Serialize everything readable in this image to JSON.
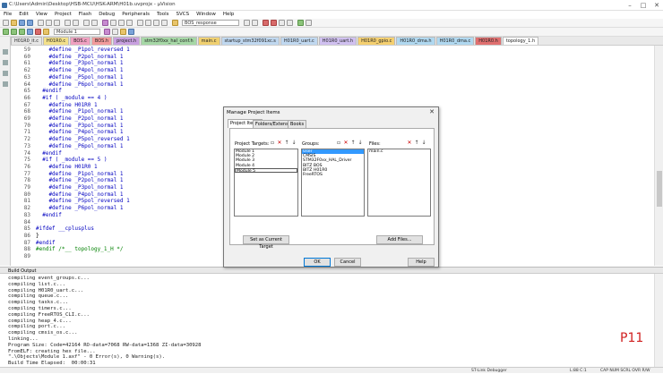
{
  "window": {
    "title": "C:\\Users\\Admin\\Desktop\\HSB-MCU\\HSK-ARM\\H01b.uvprojx - µVision",
    "controls": [
      "–",
      "□",
      "✕"
    ]
  },
  "menu": [
    "File",
    "Edit",
    "View",
    "Project",
    "Flash",
    "Debug",
    "Peripherals",
    "Tools",
    "SVCS",
    "Window",
    "Help"
  ],
  "toolbar": {
    "find_value": "BOS_response",
    "target_value": "Module 1"
  },
  "file_tabs": [
    "H01R0_it.c",
    "H01R0.c",
    "BOS.c",
    "BOS.h",
    "project.h",
    "stm32f0xx_hal_conf.h",
    "main.c",
    "startup_stm32f091xc.s",
    "H01R0_uart.c",
    "H01R0_uart.h",
    "H01R0_gpio.c",
    "H01R0_dma.h",
    "H01R0_dma.c",
    "H01R0.h",
    "topology_1.h"
  ],
  "code_lines": [
    {
      "n": "59",
      "text": "    #define _P1pol_reversed 1"
    },
    {
      "n": "60",
      "text": "    #define _P2pol_normal 1"
    },
    {
      "n": "61",
      "text": "    #define _P3pol_normal 1"
    },
    {
      "n": "62",
      "text": "    #define _P4pol_normal 1"
    },
    {
      "n": "63",
      "text": "    #define _P5pol_normal 1"
    },
    {
      "n": "64",
      "text": "    #define _P6pol_normal 1"
    },
    {
      "n": "65",
      "text": "  #endif"
    },
    {
      "n": "66",
      "text": "  #if ( _module == 4 )"
    },
    {
      "n": "67",
      "text": "    #define H01R0 1"
    },
    {
      "n": "68",
      "text": "    #define _P1pol_normal 1"
    },
    {
      "n": "69",
      "text": "    #define _P2pol_normal 1"
    },
    {
      "n": "70",
      "text": "    #define _P3pol_normal 1"
    },
    {
      "n": "71",
      "text": "    #define _P4pol_normal 1"
    },
    {
      "n": "72",
      "text": "    #define _P5pol_reversed 1"
    },
    {
      "n": "73",
      "text": "    #define _P6pol_normal 1"
    },
    {
      "n": "74",
      "text": "  #endif"
    },
    {
      "n": "75",
      "text": "  #if ( _module == 5 )"
    },
    {
      "n": "76",
      "text": "    #define H01R0 1"
    },
    {
      "n": "77",
      "text": "    #define _P1pol_normal 1"
    },
    {
      "n": "78",
      "text": "    #define _P2pol_normal 1"
    },
    {
      "n": "79",
      "text": "    #define _P3pol_normal 1"
    },
    {
      "n": "80",
      "text": "    #define _P4pol_normal 1"
    },
    {
      "n": "81",
      "text": "    #define _P5pol_reversed 1"
    },
    {
      "n": "82",
      "text": "    #define _P6pol_normal 1"
    },
    {
      "n": "83",
      "text": "  #endif"
    },
    {
      "n": "84",
      "text": ""
    },
    {
      "n": "85",
      "text": "#ifdef __cplusplus"
    },
    {
      "n": "86",
      "text": "}"
    },
    {
      "n": "87",
      "text": "#endif"
    },
    {
      "n": "88",
      "text": "#endif /*__ topology_1_H */"
    },
    {
      "n": "89",
      "text": ""
    }
  ],
  "build": {
    "title": "Build Output",
    "lines": [
      "compiling event_groups.c...",
      "compiling list.c...",
      "compiling H01R0_uart.c...",
      "compiling queue.c...",
      "compiling tasks.c...",
      "compiling timers.c...",
      "compiling FreeRTOS_CLI.c...",
      "compiling heap_4.c...",
      "compiling port.c...",
      "compiling cmsis_os.c...",
      "linking...",
      "Program Size: Code=42164 RO-data=7068 RW-data=1368 ZI-data=30928",
      "FromELF: creating hex file...",
      "\".\\Objects\\Module 1.axf\" - 0 Error(s), 0 Warning(s).",
      "Build Time Elapsed:  00:00:31"
    ]
  },
  "overlay_label": "P11",
  "status": {
    "debugger": "ST-Link Debugger",
    "position": "L:88 C:1",
    "flags": "CAP  NUM  SCRL  OVR  R/W"
  },
  "dialog": {
    "title": "Manage Project Items",
    "tabs": [
      "Project Items",
      "Folders/Extensions",
      "Books"
    ],
    "targets_label": "Project Targets:",
    "groups_label": "Groups:",
    "files_label": "Files:",
    "targets": [
      "Module 1",
      "Module 2",
      "Module 3",
      "Module 4",
      "Module 5"
    ],
    "groups": [
      "User",
      "CMSIS",
      "STM32F0xx_HAL_Driver",
      "BITZ BOS",
      "BITZ H01R0",
      "FreeRTOS"
    ],
    "files": [
      "main.c"
    ],
    "set_current_label": "Set as Current Target",
    "add_files_label": "Add Files...",
    "ok_label": "OK",
    "cancel_label": "Cancel",
    "help_label": "Help"
  }
}
